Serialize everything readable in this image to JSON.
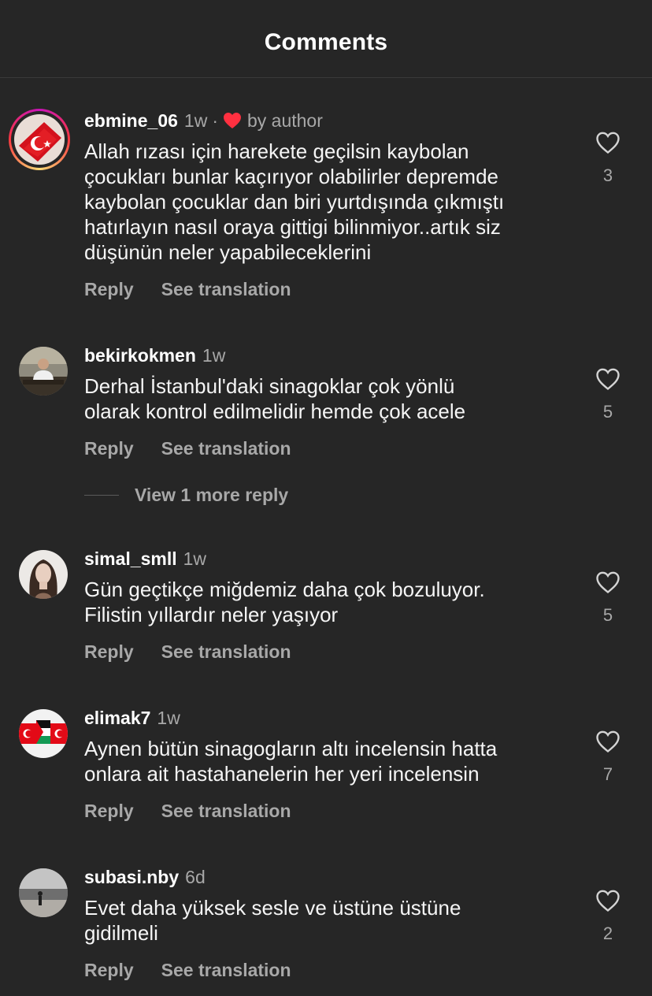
{
  "header": {
    "title": "Comments"
  },
  "comments": [
    {
      "username": "ebmine_06",
      "time": "1w",
      "dot": "·",
      "liked_by_author": "by author",
      "text": "Allah rızası için harekete geçilsin kaybolan\nçocukları bunlar kaçırıyor olabilirler depremde\nkaybolan çocuklar dan biri yurtdışında çıkmıştı\nhatırlayın nasıl oraya gittigi bilinmiyor..artık siz\ndüşünün neler yapabileceklerini",
      "likes": "3",
      "reply_label": "Reply",
      "translate_label": "See translation",
      "avatar_icon": "turkish-flag-avatar"
    },
    {
      "username": "bekirkokmen",
      "time": "1w",
      "text": "Derhal İstanbul'daki sinagoklar çok yönlü\nolarak kontrol edilmelidir hemde çok acele",
      "likes": "5",
      "reply_label": "Reply",
      "translate_label": "See translation",
      "view_more": "View 1 more reply",
      "avatar_icon": "man-at-desk-avatar"
    },
    {
      "username": "simal_smll",
      "time": "1w",
      "text": "Gün geçtikçe miğdemiz daha çok bozuluyor.\nFilistin yıllardır neler yaşıyor",
      "likes": "5",
      "reply_label": "Reply",
      "translate_label": "See translation",
      "avatar_icon": "woman-portrait-avatar"
    },
    {
      "username": "elimak7",
      "time": "1w",
      "text": "Aynen bütün sinagogların altı incelensin hatta\nonlara ait hastahanelerin her yeri incelensin",
      "likes": "7",
      "reply_label": "Reply",
      "translate_label": "See translation",
      "avatar_icon": "flags-avatar"
    },
    {
      "username": "subasi.nby",
      "time": "6d",
      "text": "Evet daha yüksek sesle ve üstüne üstüne\ngidilmeli",
      "likes": "2",
      "reply_label": "Reply",
      "translate_label": "See translation",
      "avatar_icon": "beach-silhouette-avatar"
    }
  ],
  "colors": {
    "background": "#262626",
    "primary_text": "#f5f5f5",
    "secondary_text": "#a8a8a8",
    "liked_heart": "#ff3040"
  }
}
